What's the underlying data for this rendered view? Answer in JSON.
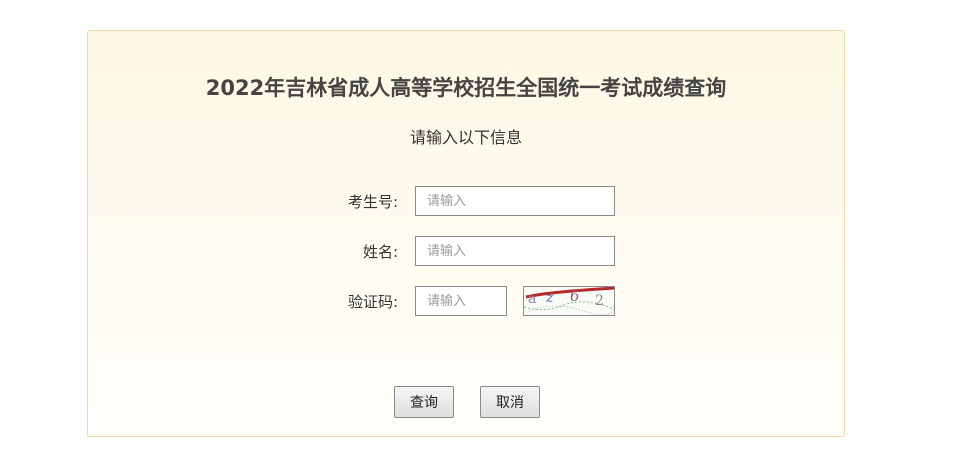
{
  "form": {
    "title": "2022年吉林省成人高等学校招生全国统一考试成绩查询",
    "subtitle": "请输入以下信息",
    "fields": {
      "exam_number": {
        "label": "考生号:",
        "placeholder": "请输入",
        "value": ""
      },
      "name": {
        "label": "姓名:",
        "placeholder": "请输入",
        "value": ""
      },
      "captcha": {
        "label": "验证码:",
        "placeholder": "请输入",
        "value": ""
      }
    },
    "captcha_image": {
      "chars": [
        "a",
        "z",
        "6",
        "2"
      ],
      "icon": "captcha-image"
    },
    "buttons": {
      "submit": "查询",
      "cancel": "取消"
    }
  },
  "colors": {
    "panel_border": "#f1d9a5",
    "panel_bg_top": "#fdf7e4",
    "panel_bg_bottom": "#fffefb",
    "title_text": "#444444",
    "input_border": "#8a8a8a"
  }
}
